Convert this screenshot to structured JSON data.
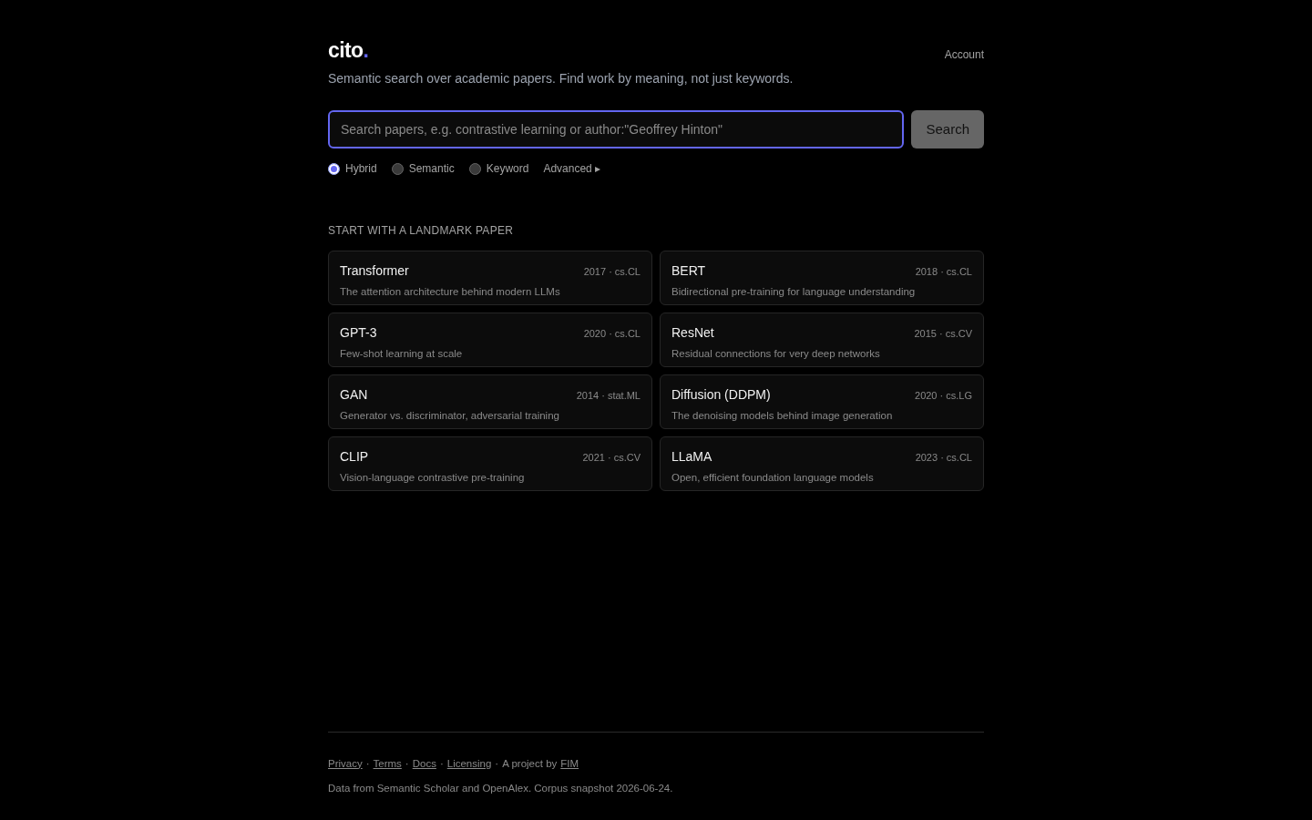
{
  "header": {
    "logo": {
      "name": "cito",
      "dot": "."
    },
    "account": "Account",
    "tagline": "Semantic search over academic papers. Find work by meaning, not just keywords."
  },
  "search": {
    "placeholder": "Search papers, e.g. contrastive learning or author:\"Geoffrey Hinton\"",
    "button": "Search",
    "focused": true
  },
  "modes": [
    {
      "label": "Hybrid",
      "selected": true
    },
    {
      "label": "Semantic",
      "selected": false
    },
    {
      "label": "Keyword",
      "selected": false
    }
  ],
  "advanced": "Advanced ▸",
  "landmarks": {
    "heading": "START WITH A LANDMARK PAPER",
    "papers": [
      {
        "title": "Transformer",
        "meta": "2017 · cs.CL",
        "description": "The attention architecture behind modern LLMs"
      },
      {
        "title": "BERT",
        "meta": "2018 · cs.CL",
        "description": "Bidirectional pre-training for language understanding"
      },
      {
        "title": "GPT-3",
        "meta": "2020 · cs.CL",
        "description": "Few-shot learning at scale"
      },
      {
        "title": "ResNet",
        "meta": "2015 · cs.CV",
        "description": "Residual connections for very deep networks"
      },
      {
        "title": "GAN",
        "meta": "2014 · stat.ML",
        "description": "Generator vs. discriminator, adversarial training"
      },
      {
        "title": "Diffusion (DDPM)",
        "meta": "2020 · cs.LG",
        "description": "The denoising models behind image generation"
      },
      {
        "title": "CLIP",
        "meta": "2021 · cs.CV",
        "description": "Vision-language contrastive pre-training"
      },
      {
        "title": "LLaMA",
        "meta": "2023 · cs.CL",
        "description": "Open, efficient foundation language models"
      }
    ]
  },
  "footer": {
    "line": [
      {
        "kind": "link",
        "text": "Privacy"
      },
      {
        "kind": "sep",
        "text": "·"
      },
      {
        "kind": "link",
        "text": "Terms"
      },
      {
        "kind": "sep",
        "text": "·"
      },
      {
        "kind": "link",
        "text": "Docs"
      },
      {
        "kind": "sep",
        "text": "·"
      },
      {
        "kind": "link",
        "text": "Licensing"
      },
      {
        "kind": "sep",
        "text": "·"
      },
      {
        "kind": "text",
        "text": "A project by"
      },
      {
        "kind": "link",
        "text": "FIM"
      }
    ],
    "note": "Data from Semantic Scholar and OpenAlex. Corpus snapshot 2026-06-24."
  }
}
